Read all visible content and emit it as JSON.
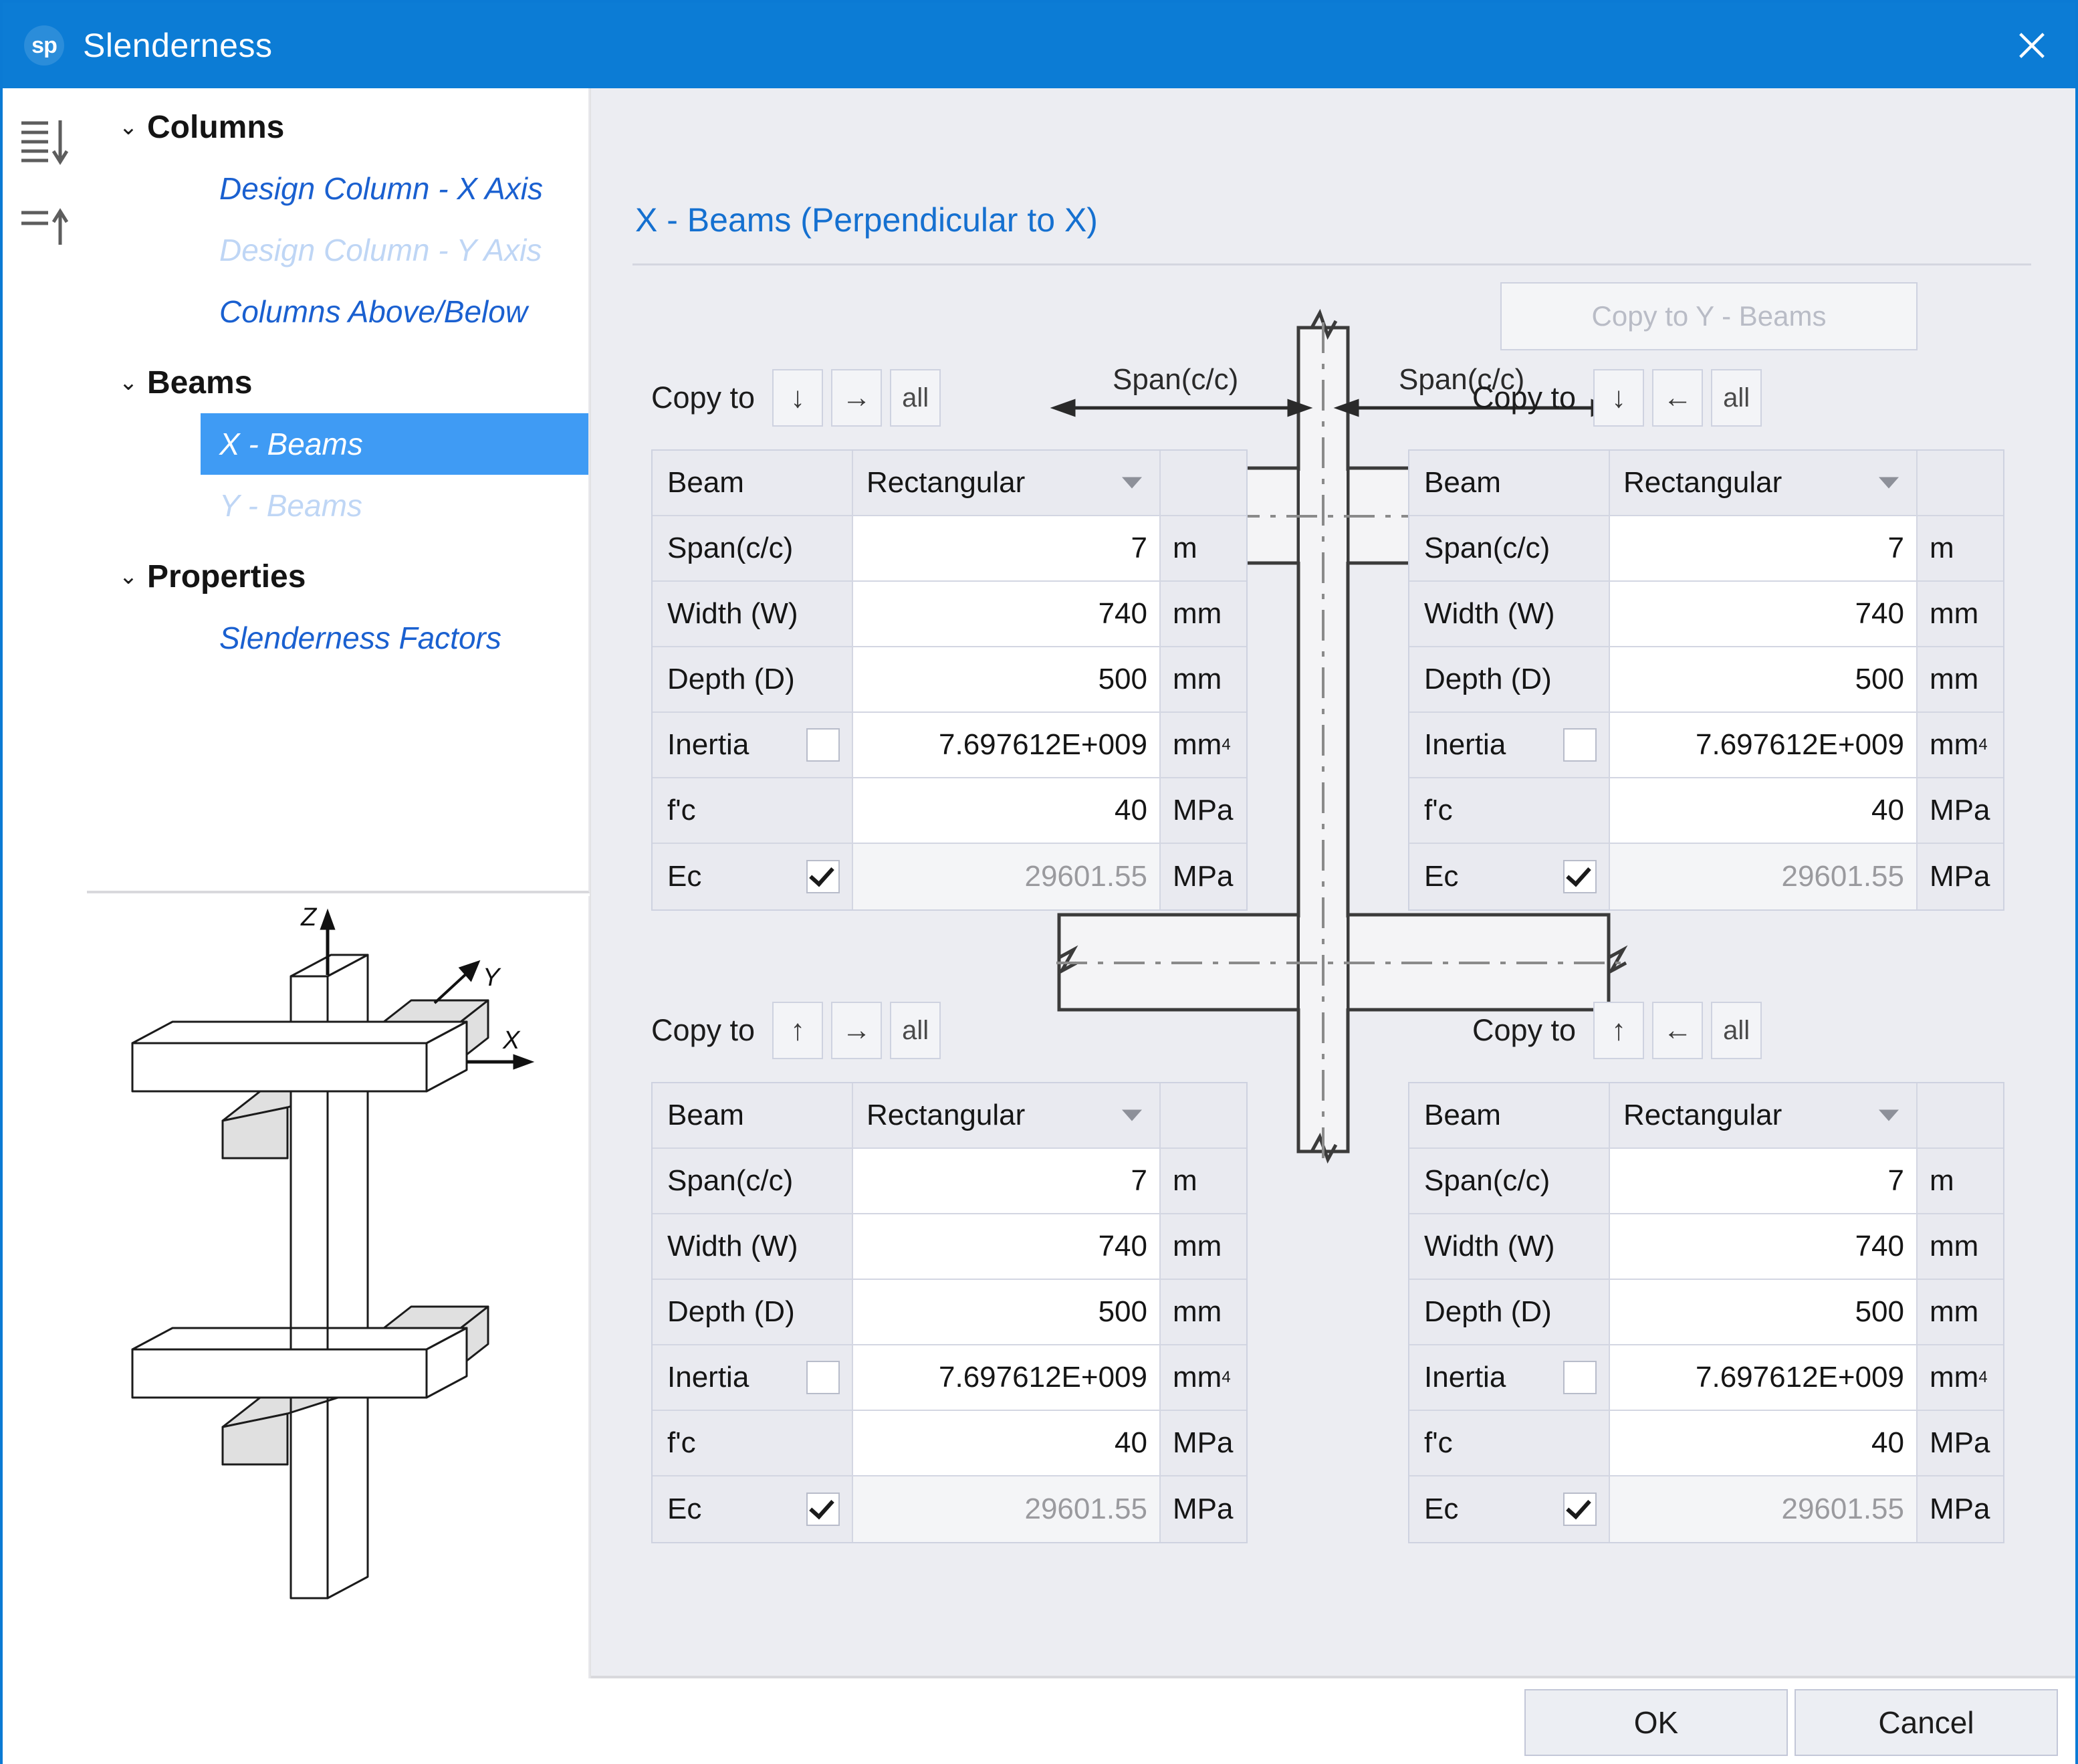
{
  "window": {
    "logo_text": "sp",
    "title": "Slenderness",
    "close_icon": "close-icon"
  },
  "rail": {
    "expand_all_icon": "expand-all-icon",
    "collapse_all_icon": "collapse-all-icon"
  },
  "tree": {
    "nodes": [
      {
        "label": "Columns",
        "expanded": true
      },
      {
        "label": "Design Column - X Axis",
        "state": "link"
      },
      {
        "label": "Design Column - Y Axis",
        "state": "disabled"
      },
      {
        "label": "Columns Above/Below",
        "state": "link"
      },
      {
        "label": "Beams",
        "expanded": true
      },
      {
        "label": "X - Beams",
        "state": "selected"
      },
      {
        "label": "Y - Beams",
        "state": "disabled"
      },
      {
        "label": "Properties",
        "expanded": true
      },
      {
        "label": "Slenderness Factors",
        "state": "link"
      }
    ]
  },
  "figure": {
    "axis_z": "Z",
    "axis_y": "Y",
    "axis_x": "X"
  },
  "main": {
    "pane_title": "X - Beams (Perpendicular to X)",
    "copy_to_y_beams": "Copy to Y - Beams"
  },
  "diagram": {
    "span_label_left": "Span(c/c)",
    "span_label_right": "Span(c/c)"
  },
  "beam_tables": [
    {
      "position": "top-left",
      "copy_to": {
        "label": "Copy to",
        "buttons": [
          "↓",
          "→",
          "all"
        ]
      },
      "rows": [
        {
          "label": "Beam",
          "value": "Rectangular",
          "unit": "",
          "kind": "select"
        },
        {
          "label": "Span(c/c)",
          "value": "7",
          "unit": "m",
          "kind": "input"
        },
        {
          "label": "Width (W)",
          "value": "740",
          "unit": "mm",
          "kind": "input"
        },
        {
          "label": "Depth (D)",
          "value": "500",
          "unit": "mm",
          "kind": "input"
        },
        {
          "label": "Inertia",
          "value": "7.697612E+009",
          "unit": "mm",
          "unit_sup": "4",
          "kind": "input",
          "checkbox": false
        },
        {
          "label": "f'c",
          "value": "40",
          "unit": "MPa",
          "kind": "input"
        },
        {
          "label": "Ec",
          "value": "29601.55",
          "unit": "MPa",
          "kind": "readonly",
          "checkbox": true
        }
      ]
    },
    {
      "position": "top-right",
      "copy_to": {
        "label": "Copy to",
        "buttons": [
          "↓",
          "←",
          "all"
        ]
      },
      "rows": [
        {
          "label": "Beam",
          "value": "Rectangular",
          "unit": "",
          "kind": "select"
        },
        {
          "label": "Span(c/c)",
          "value": "7",
          "unit": "m",
          "kind": "input"
        },
        {
          "label": "Width (W)",
          "value": "740",
          "unit": "mm",
          "kind": "input"
        },
        {
          "label": "Depth (D)",
          "value": "500",
          "unit": "mm",
          "kind": "input"
        },
        {
          "label": "Inertia",
          "value": "7.697612E+009",
          "unit": "mm",
          "unit_sup": "4",
          "kind": "input",
          "checkbox": false
        },
        {
          "label": "f'c",
          "value": "40",
          "unit": "MPa",
          "kind": "input"
        },
        {
          "label": "Ec",
          "value": "29601.55",
          "unit": "MPa",
          "kind": "readonly",
          "checkbox": true
        }
      ]
    },
    {
      "position": "bottom-left",
      "copy_to": {
        "label": "Copy to",
        "buttons": [
          "↑",
          "→",
          "all"
        ]
      },
      "rows": [
        {
          "label": "Beam",
          "value": "Rectangular",
          "unit": "",
          "kind": "select"
        },
        {
          "label": "Span(c/c)",
          "value": "7",
          "unit": "m",
          "kind": "input"
        },
        {
          "label": "Width (W)",
          "value": "740",
          "unit": "mm",
          "kind": "input"
        },
        {
          "label": "Depth (D)",
          "value": "500",
          "unit": "mm",
          "kind": "input"
        },
        {
          "label": "Inertia",
          "value": "7.697612E+009",
          "unit": "mm",
          "unit_sup": "4",
          "kind": "input",
          "checkbox": false
        },
        {
          "label": "f'c",
          "value": "40",
          "unit": "MPa",
          "kind": "input"
        },
        {
          "label": "Ec",
          "value": "29601.55",
          "unit": "MPa",
          "kind": "readonly",
          "checkbox": true
        }
      ]
    },
    {
      "position": "bottom-right",
      "copy_to": {
        "label": "Copy to",
        "buttons": [
          "↑",
          "←",
          "all"
        ]
      },
      "rows": [
        {
          "label": "Beam",
          "value": "Rectangular",
          "unit": "",
          "kind": "select"
        },
        {
          "label": "Span(c/c)",
          "value": "7",
          "unit": "m",
          "kind": "input"
        },
        {
          "label": "Width (W)",
          "value": "740",
          "unit": "mm",
          "kind": "input"
        },
        {
          "label": "Depth (D)",
          "value": "500",
          "unit": "mm",
          "kind": "input"
        },
        {
          "label": "Inertia",
          "value": "7.697612E+009",
          "unit": "mm",
          "unit_sup": "4",
          "kind": "input",
          "checkbox": false
        },
        {
          "label": "f'c",
          "value": "40",
          "unit": "MPa",
          "kind": "input"
        },
        {
          "label": "Ec",
          "value": "29601.55",
          "unit": "MPa",
          "kind": "readonly",
          "checkbox": true
        }
      ]
    }
  ],
  "footer": {
    "ok_label": "OK",
    "cancel_label": "Cancel"
  },
  "colors": {
    "titlebar": "#0c7cd5",
    "accent_link": "#1a60d0",
    "selection": "#3f9bf4",
    "pane_bg": "#ecedf2",
    "pane_title": "#1570d0"
  }
}
